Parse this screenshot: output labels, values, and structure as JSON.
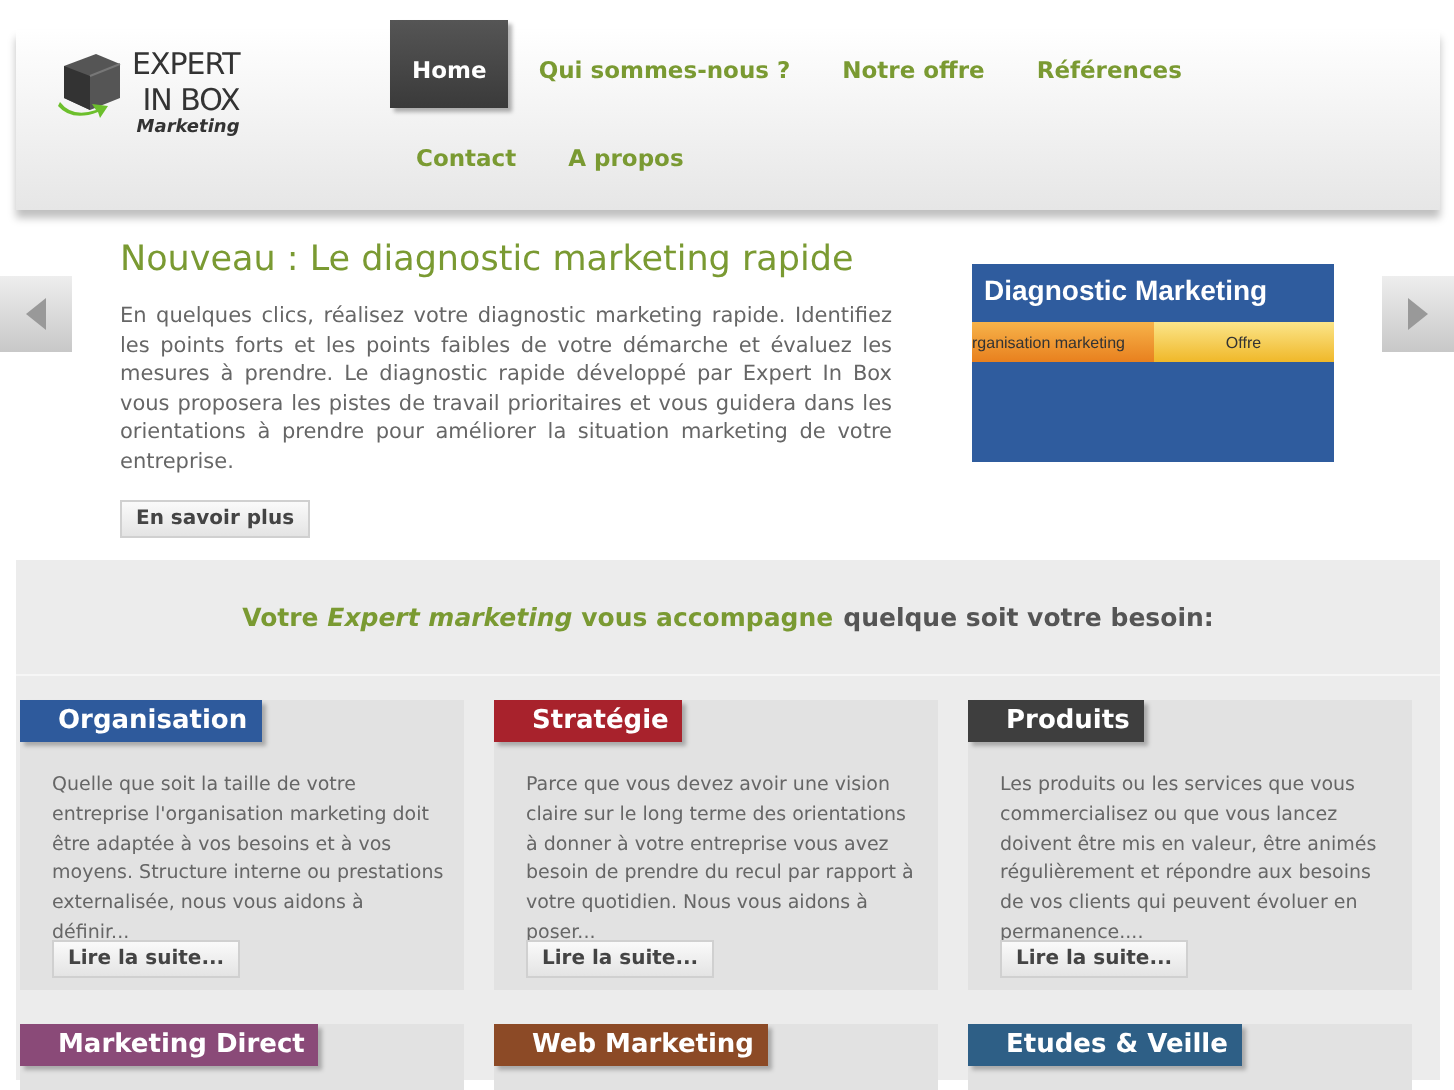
{
  "header": {
    "logo": {
      "line1": "EXPERT",
      "line2": "IN BOX",
      "line3": "Marketing"
    },
    "nav": [
      {
        "label": "Home",
        "selected": true
      },
      {
        "label": "Qui sommes-nous ?",
        "selected": false
      },
      {
        "label": "Notre offre",
        "selected": false
      },
      {
        "label": "Références",
        "selected": false
      },
      {
        "label": "Contact",
        "selected": false
      },
      {
        "label": "A propos",
        "selected": false
      }
    ]
  },
  "slider": {
    "title": "Nouveau : Le diagnostic marketing rapide",
    "text": "En quelques clics, réalisez votre diagnostic marketing rapide. Identifiez les points forts et les points faibles de votre démarche et évaluez les mesures à prendre. Le diagnostic rapide développé par Expert In Box vous proposera les pistes de travail prioritaires et vous guidera dans les orientations à prendre pour améliorer la situation marketing de votre entreprise.",
    "button": "En savoir plus",
    "banner": {
      "title": "Diagnostic Marketing",
      "steps": [
        "rganisation marketing",
        "Offre"
      ]
    }
  },
  "tagline": {
    "highlight": "Votre *Expert marketing* vous accompagne",
    "rest": "quelque soit votre besoin:"
  },
  "cards": [
    {
      "title": "Organisation",
      "color": "#2e5a9c",
      "text": "Quelle que soit la taille de votre entreprise l'organisation marketing doit être adaptée à vos besoins et à vos moyens. Structure interne ou prestations externalisée, nous vous aidons à définir...",
      "button": "Lire la suite..."
    },
    {
      "title": "Stratégie",
      "color": "#a8222c",
      "text": "Parce que vous devez avoir une vision claire sur le long terme des orientations à donner à votre entreprise vous avez besoin de prendre du recul par rapport à votre quotidien. Nous vous aidons à poser...",
      "button": "Lire la suite..."
    },
    {
      "title": "Produits",
      "color": "#3e3e3e",
      "text": "Les produits ou les services que vous commercialisez ou que vous lancez doivent être mis en valeur, être animés régulièrement et répondre aux besoins de vos clients qui peuvent évoluer en permanence....",
      "button": "Lire la suite..."
    },
    {
      "title": "Marketing Direct",
      "color": "#8a4a78"
    },
    {
      "title": "Web Marketing",
      "color": "#8c4a26"
    },
    {
      "title": "Etudes & Veille",
      "color": "#2e5f86"
    }
  ]
}
